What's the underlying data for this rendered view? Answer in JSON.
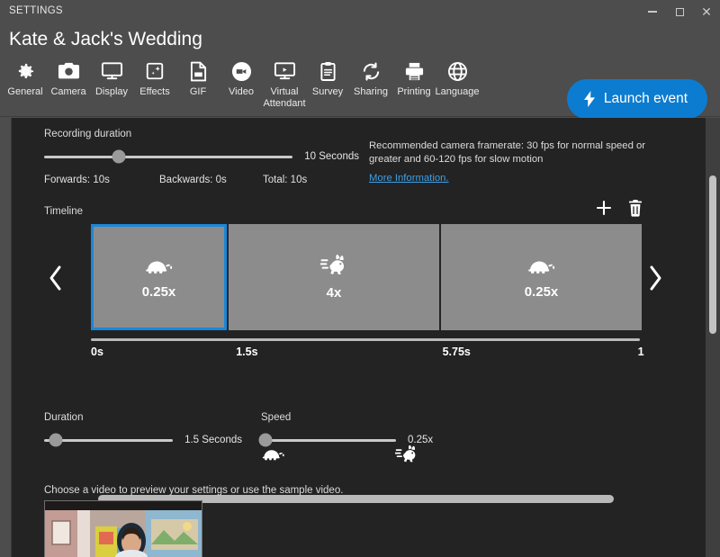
{
  "window": {
    "app_label": "SETTINGS",
    "minimize": "Minimize",
    "maximize": "Maximize",
    "close": "Close"
  },
  "header": {
    "event_title": "Kate & Jack's Wedding",
    "launch_label": "Launch event",
    "accent_color": "#0c7cd0",
    "tools": [
      {
        "label": "General",
        "icon": "gear-icon"
      },
      {
        "label": "Camera",
        "icon": "camera-icon"
      },
      {
        "label": "Display",
        "icon": "monitor-icon"
      },
      {
        "label": "Effects",
        "icon": "sparkle-icon"
      },
      {
        "label": "GIF",
        "icon": "gif-file-icon"
      },
      {
        "label": "Video",
        "icon": "video-icon"
      },
      {
        "label": "Virtual Attendant",
        "icon": "virtual-attendant-icon"
      },
      {
        "label": "Survey",
        "icon": "clipboard-icon"
      },
      {
        "label": "Sharing",
        "icon": "share-refresh-icon"
      },
      {
        "label": "Printing",
        "icon": "printer-icon"
      },
      {
        "label": "Language",
        "icon": "globe-icon"
      }
    ]
  },
  "recording": {
    "label": "Recording duration",
    "value": "10 Seconds",
    "slider_percent": 30,
    "forwards": "Forwards: 10s",
    "backwards": "Backwards: 0s",
    "total": "Total: 10s",
    "recommendation": "Recommended camera framerate: 30 fps for normal speed or greater and 60-120 fps for slow motion",
    "more_info": "More Information."
  },
  "timeline": {
    "label": "Timeline",
    "add_label": "Add",
    "delete_label": "Delete",
    "prev_label": "Previous",
    "next_label": "Next",
    "clips": [
      {
        "speed": "0.25x",
        "icon": "turtle-icon",
        "selected": true
      },
      {
        "speed": "4x",
        "icon": "rabbit-icon",
        "selected": false
      },
      {
        "speed": "0.25x",
        "icon": "turtle-icon",
        "selected": false
      }
    ],
    "ticks": [
      {
        "label": "0s",
        "pos": 0
      },
      {
        "label": "1.5s",
        "pos": 26
      },
      {
        "label": "5.75s",
        "pos": 63
      },
      {
        "label": "1",
        "pos": 98
      }
    ]
  },
  "duration": {
    "label": "Duration",
    "value": "1.5 Seconds",
    "slider_percent": 9
  },
  "speed": {
    "label": "Speed",
    "value": "0.25x",
    "slider_percent": 3,
    "slow_icon": "turtle-icon",
    "fast_icon": "rabbit-icon"
  },
  "preview": {
    "label": "Choose a video to preview your settings or use the sample video."
  }
}
